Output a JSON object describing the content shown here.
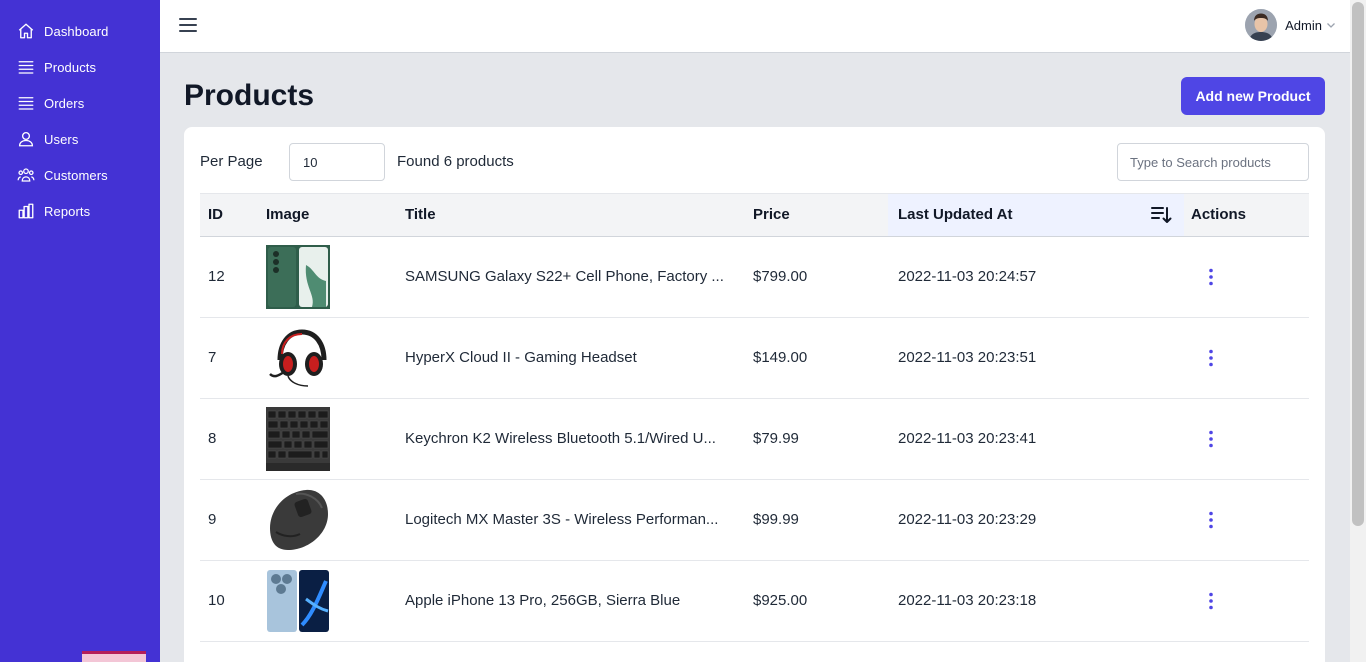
{
  "sidebar": {
    "items": [
      {
        "label": "Dashboard",
        "icon": "home-icon"
      },
      {
        "label": "Products",
        "icon": "list-icon"
      },
      {
        "label": "Orders",
        "icon": "list-icon"
      },
      {
        "label": "Users",
        "icon": "user-icon"
      },
      {
        "label": "Customers",
        "icon": "users-group-icon"
      },
      {
        "label": "Reports",
        "icon": "bar-chart-icon"
      }
    ]
  },
  "header": {
    "user_name": "Admin"
  },
  "page": {
    "title": "Products",
    "add_button_label": "Add new Product"
  },
  "toolbar": {
    "per_page_label": "Per Page",
    "per_page_value": "10",
    "found_text": "Found 6 products",
    "search_placeholder": "Type to Search products"
  },
  "table": {
    "columns": [
      "ID",
      "Image",
      "Title",
      "Price",
      "Last Updated At",
      "Actions"
    ],
    "sorted_column": "Last Updated At",
    "rows": [
      {
        "id": "12",
        "image": "green-phone",
        "title": "SAMSUNG Galaxy S22+ Cell Phone, Factory ...",
        "price": "$799.00",
        "updated": "2022-11-03 20:24:57"
      },
      {
        "id": "7",
        "image": "red-headset",
        "title": "HyperX Cloud II - Gaming Headset",
        "price": "$149.00",
        "updated": "2022-11-03 20:23:51"
      },
      {
        "id": "8",
        "image": "keyboard",
        "title": "Keychron K2 Wireless Bluetooth 5.1/Wired U...",
        "price": "$79.99",
        "updated": "2022-11-03 20:23:41"
      },
      {
        "id": "9",
        "image": "mouse",
        "title": "Logitech MX Master 3S - Wireless Performan...",
        "price": "$99.99",
        "updated": "2022-11-03 20:23:29"
      },
      {
        "id": "10",
        "image": "blue-iphone",
        "title": "Apple iPhone 13 Pro, 256GB, Sierra Blue",
        "price": "$925.00",
        "updated": "2022-11-03 20:23:18"
      }
    ]
  },
  "colors": {
    "sidebar_bg": "#4432d4",
    "accent": "#4f46e5",
    "page_bg": "#e5e7eb"
  }
}
